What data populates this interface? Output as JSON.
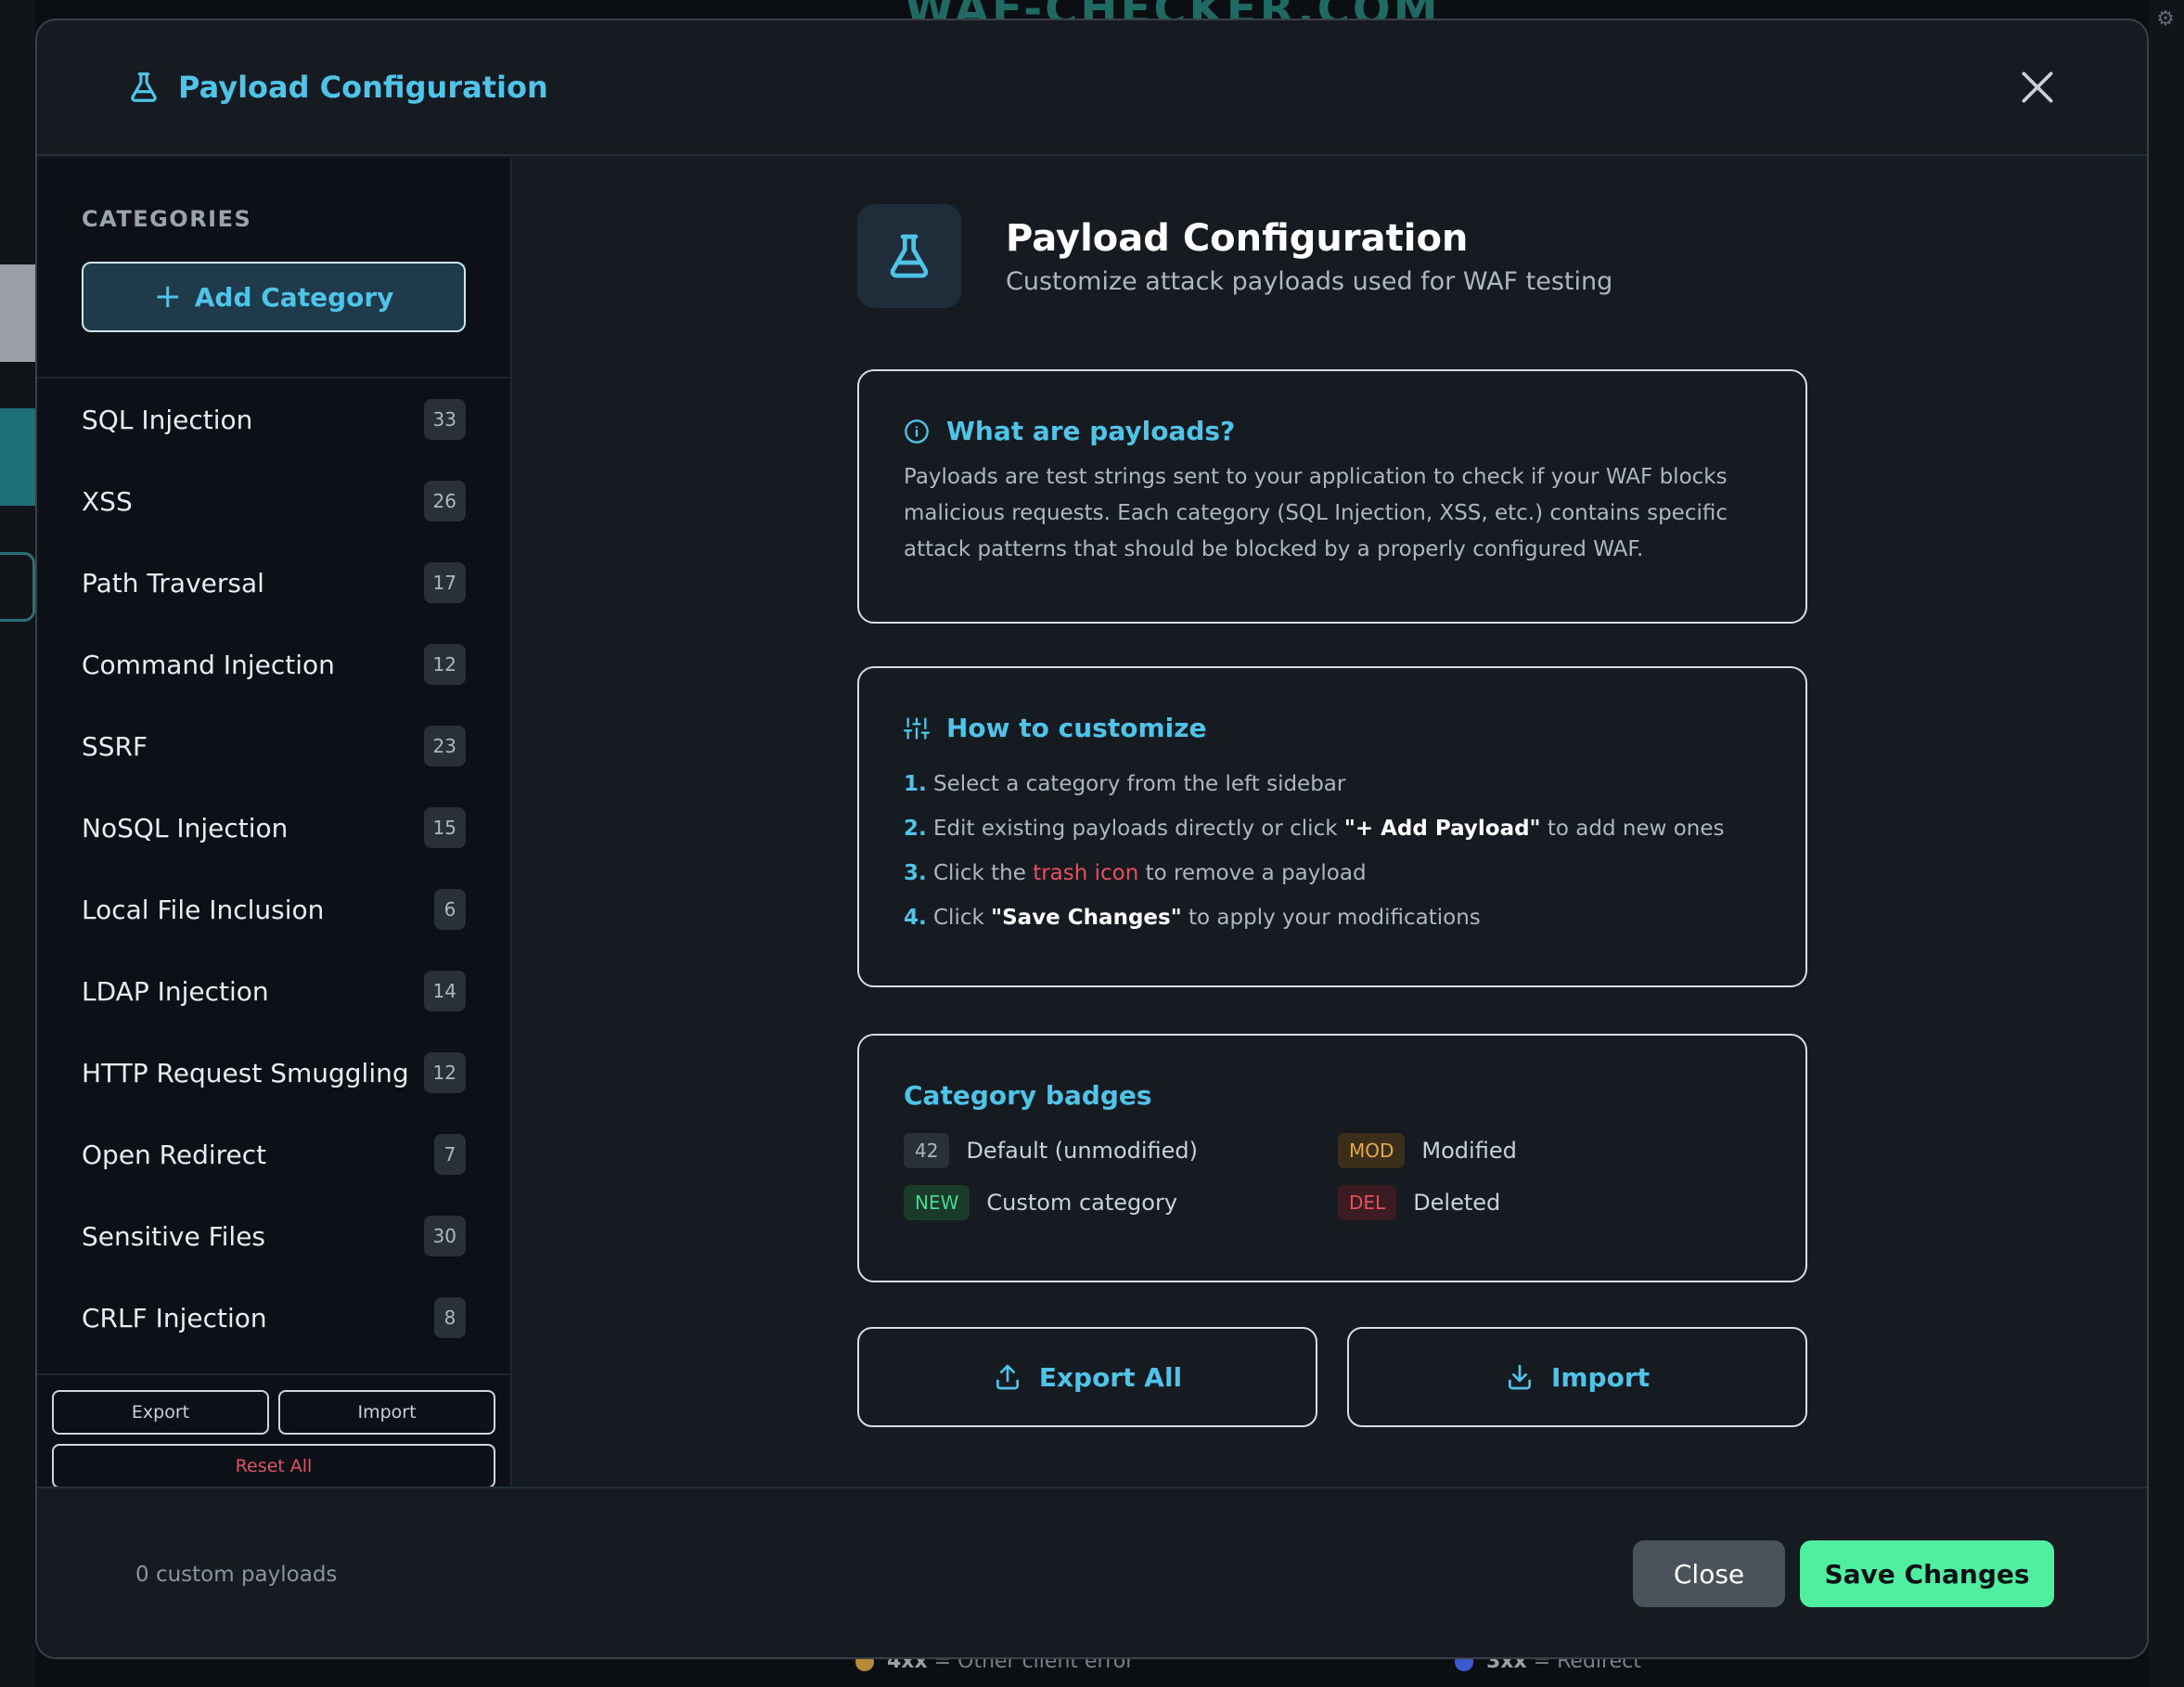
{
  "background": {
    "site_title": "WAF-CHECKER.COM",
    "legend": [
      {
        "code": "4xx",
        "text": " = Other client error",
        "color": "#b58a3a"
      },
      {
        "code": "3xx",
        "text": " = Redirect",
        "color": "#3a5bd0"
      }
    ]
  },
  "modal": {
    "title": "Payload Configuration",
    "close_icon": "close-icon"
  },
  "sidebar": {
    "heading": "CATEGORIES",
    "add_label": "Add Category",
    "categories": [
      {
        "name": "SQL Injection",
        "count": "33"
      },
      {
        "name": "XSS",
        "count": "26"
      },
      {
        "name": "Path Traversal",
        "count": "17"
      },
      {
        "name": "Command Injection",
        "count": "12"
      },
      {
        "name": "SSRF",
        "count": "23"
      },
      {
        "name": "NoSQL Injection",
        "count": "15"
      },
      {
        "name": "Local File Inclusion",
        "count": "6"
      },
      {
        "name": "LDAP Injection",
        "count": "14"
      },
      {
        "name": "HTTP Request Smuggling",
        "count": "12"
      },
      {
        "name": "Open Redirect",
        "count": "7"
      },
      {
        "name": "Sensitive Files",
        "count": "30"
      },
      {
        "name": "CRLF Injection",
        "count": "8"
      }
    ],
    "export_label": "Export",
    "import_label": "Import",
    "reset_label": "Reset All"
  },
  "main": {
    "title": "Payload Configuration",
    "subtitle": "Customize attack payloads used for WAF testing",
    "what": {
      "title": "What are payloads?",
      "body": "Payloads are test strings sent to your application to check if your WAF blocks malicious requests. Each category (SQL Injection, XSS, etc.) contains specific attack patterns that should be blocked by a properly configured WAF."
    },
    "how": {
      "title": "How to customize",
      "steps": [
        {
          "num": "1.",
          "pre": "Select a category from the left sidebar",
          "hl": "",
          "post": ""
        },
        {
          "num": "2.",
          "pre": "Edit existing payloads directly or click ",
          "hl": "\"+ Add Payload\"",
          "post": " to add new ones"
        },
        {
          "num": "3.",
          "pre": "Click the ",
          "hl": "trash icon",
          "post": " to remove a payload"
        },
        {
          "num": "4.",
          "pre": "Click ",
          "hl": "\"Save Changes\"",
          "post": " to apply your modifications"
        }
      ]
    },
    "badges": {
      "title": "Category badges",
      "default_pill": "42",
      "default_label": "Default (unmodified)",
      "mod_pill": "MOD",
      "mod_label": "Modified",
      "new_pill": "NEW",
      "new_label": "Custom category",
      "del_pill": "DEL",
      "del_label": "Deleted"
    },
    "export_all": "Export All",
    "import": "Import"
  },
  "footer": {
    "custom_count": "0 custom payloads",
    "close_label": "Close",
    "save_label": "Save Changes"
  },
  "colors": {
    "accent": "#4fc3e8",
    "save": "#4ef0a0",
    "danger": "#e8505b"
  }
}
